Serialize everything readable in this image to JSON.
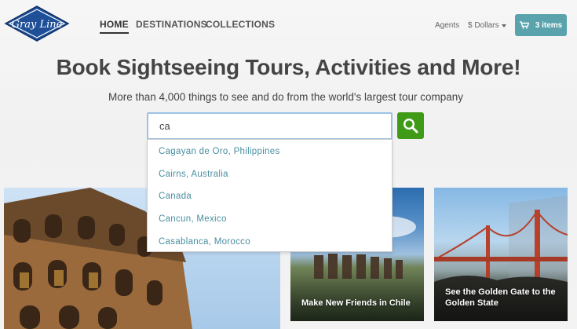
{
  "brand": {
    "logo_text": "Gray Line"
  },
  "nav": {
    "items": [
      {
        "label": "HOME",
        "active": true
      },
      {
        "label": "DESTINATIONS",
        "active": false
      },
      {
        "label": "COLLECTIONS",
        "active": false
      }
    ]
  },
  "header": {
    "agents_label": "Agents",
    "currency_label": "$ Dollars",
    "cart_label": "3 items"
  },
  "hero": {
    "headline": "Book Sightseeing Tours, Activities and More!",
    "subline": "More than 4,000 things to see and do from the world's largest tour company"
  },
  "search": {
    "value": "ca",
    "suggestions": [
      "Cagayan de Oro, Philippines",
      "Cairns, Australia",
      "Canada",
      "Cancun, Mexico",
      "Casablanca, Morocco"
    ]
  },
  "cards": [
    {
      "name": "colosseum",
      "caption": ""
    },
    {
      "name": "chile",
      "caption": "Make New Friends in Chile"
    },
    {
      "name": "golden-gate",
      "caption": "See the Golden Gate to the Golden State"
    }
  ],
  "colors": {
    "accent": "#5aa3ad",
    "search_button": "#3f9a18",
    "logo_blue": "#1e4f97",
    "suggestion_text": "#4a8fa0"
  }
}
